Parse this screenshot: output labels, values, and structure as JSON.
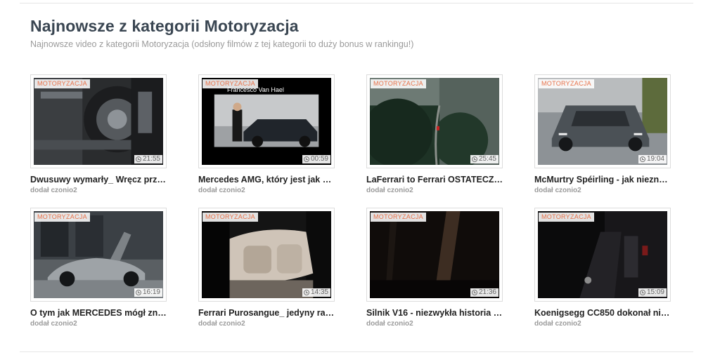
{
  "section": {
    "title": "Najnowsze z kategorii Motoryzacja",
    "subtitle": "Najnowsze video z kategorii Motoryzacja (odsłony filmów z tej kategorii to duży bonus w rankingu!)"
  },
  "colors": {
    "badge_text": "#e8724a",
    "title_text": "#3a4652"
  },
  "videos": [
    {
      "category": "MOTORYZACJA",
      "duration": "21:55",
      "title": "Dwusuwy wymarły_ Wręcz prz…",
      "uploader": "dodał czonio2"
    },
    {
      "category": "MOTORYZACJA",
      "duration": "00:59",
      "title": "Mercedes AMG, który jest jak …",
      "uploader": "dodał czonio2",
      "overlay_text": "Francesco Van Hael"
    },
    {
      "category": "MOTORYZACJA",
      "duration": "25:45",
      "title": "LaFerrari to Ferrari OSTATECZ…",
      "uploader": "dodał czonio2"
    },
    {
      "category": "MOTORYZACJA",
      "duration": "19:04",
      "title": "McMurtry Spéirling - jak niezn…",
      "uploader": "dodał czonio2"
    },
    {
      "category": "MOTORYZACJA",
      "duration": "16:19",
      "title": "O tym jak MERCEDES mógł zn…",
      "uploader": "dodał czonio2"
    },
    {
      "category": "MOTORYZACJA",
      "duration": "14:35",
      "title": "Ferrari Purosangue_ jedyny ra…",
      "uploader": "dodał czonio2"
    },
    {
      "category": "MOTORYZACJA",
      "duration": "21:36",
      "title": "Silnik V16 - niezwykła historia …",
      "uploader": "dodał czonio2"
    },
    {
      "category": "MOTORYZACJA",
      "duration": "15:09",
      "title": "Koenigsegg CC850 dokonał ni…",
      "uploader": "dodał czonio2"
    }
  ]
}
